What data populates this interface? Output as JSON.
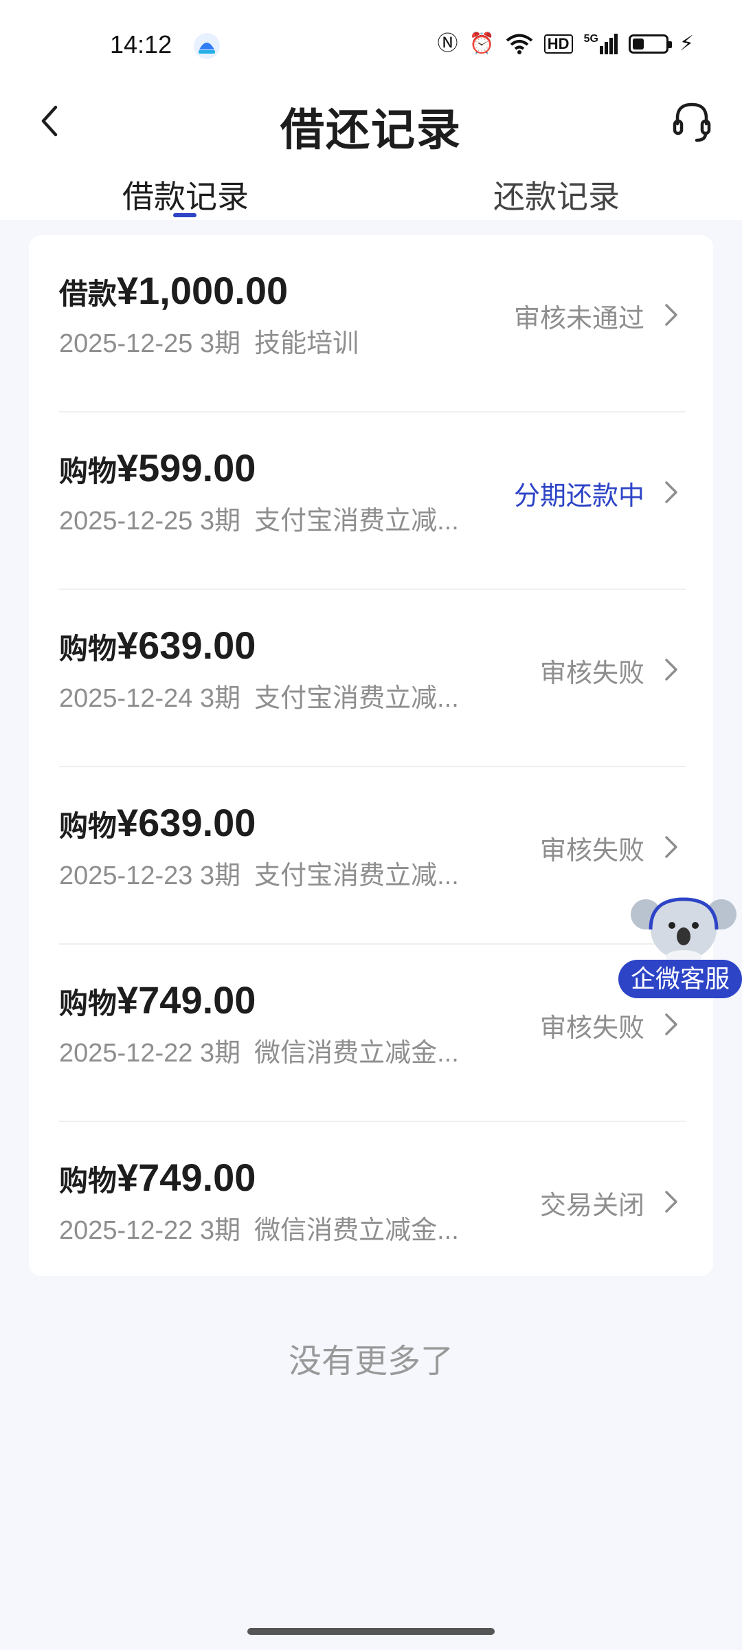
{
  "status_bar": {
    "time": "14:12",
    "network": "5G",
    "hd": "HD",
    "battery_level": 0.35
  },
  "header": {
    "title": "借还记录"
  },
  "tabs": [
    {
      "label": "借款记录",
      "active": true
    },
    {
      "label": "还款记录",
      "active": false
    }
  ],
  "records": [
    {
      "type": "借款",
      "amount": "¥1,000.00",
      "date": "2025-12-25",
      "periods": "3期",
      "purpose": "技能培训",
      "status": "审核未通过",
      "status_color": "#8e8e8e"
    },
    {
      "type": "购物",
      "amount": "¥599.00",
      "date": "2025-12-25",
      "periods": "3期",
      "purpose": "支付宝消费立减...",
      "status": "分期还款中",
      "status_color": "#2d44c7"
    },
    {
      "type": "购物",
      "amount": "¥639.00",
      "date": "2025-12-24",
      "periods": "3期",
      "purpose": "支付宝消费立减...",
      "status": "审核失败",
      "status_color": "#8e8e8e"
    },
    {
      "type": "购物",
      "amount": "¥639.00",
      "date": "2025-12-23",
      "periods": "3期",
      "purpose": "支付宝消费立减...",
      "status": "审核失败",
      "status_color": "#8e8e8e"
    },
    {
      "type": "购物",
      "amount": "¥749.00",
      "date": "2025-12-22",
      "periods": "3期",
      "purpose": "微信消费立减金...",
      "status": "审核失败",
      "status_color": "#8e8e8e"
    },
    {
      "type": "购物",
      "amount": "¥749.00",
      "date": "2025-12-22",
      "periods": "3期",
      "purpose": "微信消费立减金...",
      "status": "交易关闭",
      "status_color": "#8e8e8e"
    }
  ],
  "footer": {
    "no_more": "没有更多了"
  },
  "floating": {
    "label": "企微客服"
  },
  "colors": {
    "accent": "#2d44c7",
    "background": "#f5f7fc",
    "muted_text": "#8e8e8e"
  }
}
